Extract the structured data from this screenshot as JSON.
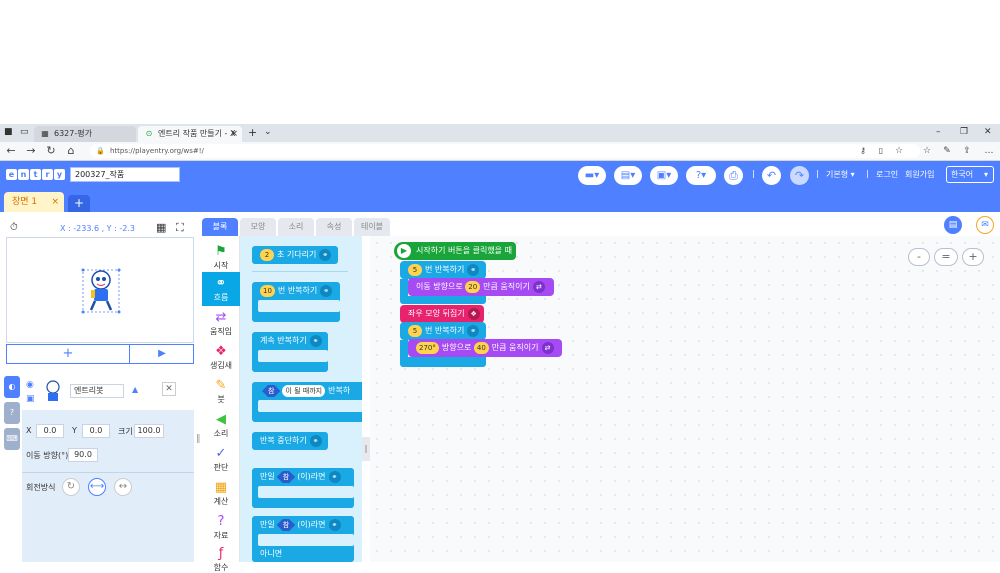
{
  "browser": {
    "tabs": [
      {
        "label": "6327-평가",
        "favicon": "grid-icon"
      },
      {
        "label": "엔트리 작품 만들기 - X",
        "favicon": "entry-icon"
      }
    ],
    "url": "https://playentry.org/ws#!/"
  },
  "header": {
    "logo": "entry",
    "project_name": "200327_작품",
    "mode_label": "기본형",
    "login_label": "로그인",
    "signup_label": "회원가입",
    "language": "한국어"
  },
  "scene": {
    "tab_label": "장면 1",
    "close": "×",
    "add": "+"
  },
  "stage": {
    "coords": "X : -233.6 , Y : -2.3",
    "add_label": "+",
    "play_label": "▶"
  },
  "object": {
    "name": "엔트리봇",
    "x_label": "X",
    "x_value": "0.0",
    "y_label": "Y",
    "y_value": "0.0",
    "size_label": "크기",
    "size_value": "100.0",
    "direction_label": "이동 방향(°)",
    "direction_value": "90.0",
    "rotation_label": "회전방식"
  },
  "palette": {
    "tabs": [
      "블록",
      "모양",
      "소리",
      "속성",
      "테이블"
    ],
    "categories": [
      {
        "label": "시작",
        "icon": "flag-icon",
        "color": "#1aa53a"
      },
      {
        "label": "흐름",
        "icon": "flow-icon",
        "color": "#ffffff"
      },
      {
        "label": "움직임",
        "icon": "move-icon",
        "color": "#a64bf4"
      },
      {
        "label": "생김새",
        "icon": "looks-icon",
        "color": "#e8236d"
      },
      {
        "label": "붓",
        "icon": "brush-icon",
        "color": "#f7a61c"
      },
      {
        "label": "소리",
        "icon": "sound-icon",
        "color": "#3ec43e"
      },
      {
        "label": "판단",
        "icon": "judge-icon",
        "color": "#5466e6"
      },
      {
        "label": "계산",
        "icon": "calc-icon",
        "color": "#f0a30a"
      },
      {
        "label": "자료",
        "icon": "data-icon",
        "color": "#a64bf4"
      },
      {
        "label": "함수",
        "icon": "func-icon",
        "color": "#e8236d"
      }
    ],
    "blocks": {
      "wait_value": "2",
      "wait_text": "초 기다리기",
      "repeat_value": "10",
      "repeat_text": "번 반복하기",
      "forever_text": "계속 반복하기",
      "until_cond": "참",
      "until_mode": "이 될 때까지",
      "until_text": "반복하",
      "break_text": "반복 중단하기",
      "if_prefix": "만일",
      "if_cond": "참",
      "if_suffix": "(이)라면",
      "ifelse_prefix": "만일",
      "ifelse_cond": "참",
      "ifelse_suffix": "(이)라면",
      "else_text": "아니면"
    }
  },
  "script": {
    "start_text": "시작하기 버튼을 클릭했을 때",
    "repeat1_value": "5",
    "repeat1_text": "번 반복하기",
    "move1_prefix": "이동 방향으로",
    "move1_value": "20",
    "move1_suffix": "만큼 움직이기",
    "flip_text": "좌우 모양 뒤집기",
    "repeat2_value": "5",
    "repeat2_text": "번 반복하기",
    "move2_value": "270°",
    "move2_mid": "방향으로",
    "move2_value2": "40",
    "move2_suffix": "만큼 움직이기"
  },
  "zoom": {
    "out": "-",
    "reset": "=",
    "in": "+"
  }
}
